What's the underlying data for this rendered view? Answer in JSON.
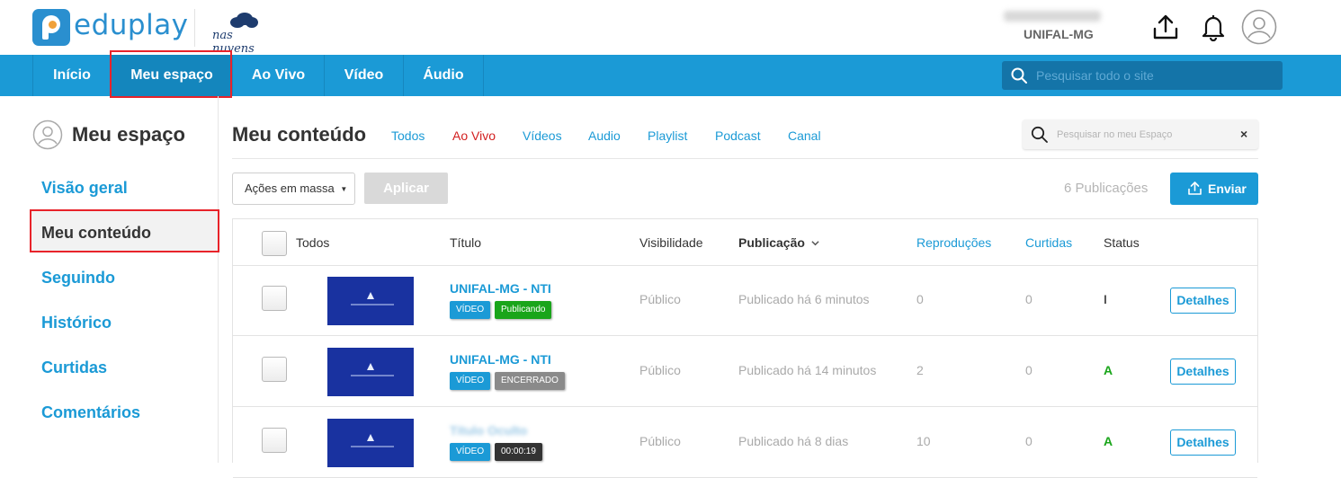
{
  "header": {
    "brand": "eduplay",
    "partner": "nas nuvens",
    "user_org": "UNIFAL-MG"
  },
  "nav": {
    "items": [
      {
        "label": "Início"
      },
      {
        "label": "Meu espaço",
        "active": true
      },
      {
        "label": "Ao Vivo"
      },
      {
        "label": "Vídeo"
      },
      {
        "label": "Áudio"
      }
    ],
    "search_placeholder": "Pesquisar todo o site"
  },
  "sidebar": {
    "title": "Meu espaço",
    "items": [
      {
        "label": "Visão geral"
      },
      {
        "label": "Meu conteúdo",
        "active": true
      },
      {
        "label": "Seguindo"
      },
      {
        "label": "Histórico"
      },
      {
        "label": "Curtidas"
      },
      {
        "label": "Comentários"
      }
    ]
  },
  "main": {
    "title": "Meu conteúdo",
    "filters": [
      "Todos",
      "Ao Vivo",
      "Vídeos",
      "Audio",
      "Playlist",
      "Podcast",
      "Canal"
    ],
    "search_placeholder": "Pesquisar no meu Espaço",
    "clear_label": "×",
    "bulk_actions_label": "Ações em massa",
    "apply_label": "Aplicar",
    "count_label": "6 Publicações",
    "send_label": "Enviar"
  },
  "table": {
    "columns": {
      "all": "Todos",
      "title": "Título",
      "visibility": "Visibilidade",
      "publication": "Publicação",
      "plays": "Reproduções",
      "likes": "Curtidas",
      "status": "Status"
    },
    "rows": [
      {
        "title": "UNIFAL-MG - NTI",
        "type_badge": "VÍDEO",
        "state_badge": "Publicando",
        "state_color": "green",
        "visibility": "Público",
        "published": "Publicado há 6 minutos",
        "plays": "0",
        "likes": "0",
        "status": "I",
        "status_color": "#555555",
        "details_label": "Detalhes"
      },
      {
        "title": "UNIFAL-MG - NTI",
        "type_badge": "VÍDEO",
        "state_badge": "ENCERRADO",
        "state_color": "gray",
        "visibility": "Público",
        "published": "Publicado há 14 minutos",
        "plays": "2",
        "likes": "0",
        "status": "A",
        "status_color": "#19a51a",
        "details_label": "Detalhes"
      },
      {
        "title": "Título Oculto",
        "title_blurred": true,
        "type_badge": "VÍDEO",
        "state_badge": "00:00:19",
        "state_color": "dark",
        "visibility": "Público",
        "published": "Publicado há 8 dias",
        "plays": "10",
        "likes": "0",
        "status": "A",
        "status_color": "#19a51a",
        "details_label": "Detalhes"
      }
    ]
  },
  "colors": {
    "accent": "#1b9ad6",
    "live": "#d21e1e",
    "highlight_border": "#e8232a"
  }
}
